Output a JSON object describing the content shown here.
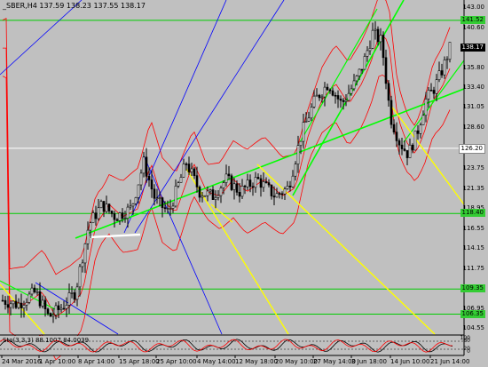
{
  "symbol_line": "_SBER,H4  137.59 138.23 137.55 138.17",
  "indicator_title": "Sto(3,3,3) 88.1007 84.0039",
  "price_scale": [
    "143.00",
    "140.60",
    "138.17",
    "135.80",
    "133.40",
    "131.05",
    "128.60",
    "126.20",
    "123.75",
    "121.35",
    "118.95",
    "116.55",
    "114.15",
    "111.75",
    "109.35",
    "106.95",
    "104.55"
  ],
  "price_tags": [
    {
      "label": "141.52",
      "style": "green"
    },
    {
      "label": "138.17",
      "style": "black"
    },
    {
      "label": "126.20",
      "style": "white"
    },
    {
      "label": "118.40",
      "style": "green"
    },
    {
      "label": "109.35",
      "style": "green"
    },
    {
      "label": "106.35",
      "style": "green"
    }
  ],
  "indicator_scale": [
    "100",
    "80",
    "20",
    "0"
  ],
  "time_scale": [
    "24 Mar 2016",
    "1 Apr 10:00",
    "8 Apr 14:00",
    "15 Apr 18:00",
    "25 Apr 10:00",
    "4 May 14:00",
    "12 May 18:00",
    "20 May 10:00",
    "27 May 14:00",
    "3 Jun 18:00",
    "14 Jun 10:00",
    "21 Jun 14:00"
  ],
  "colors": {
    "background": "#c0c0c0",
    "candle": "#000000",
    "bollinger": "#ff0000",
    "trend_green": "#00ff00",
    "trend_yellow": "#ffff00",
    "fan_blue": "#0000ff",
    "level_green": "#00cc00"
  }
}
